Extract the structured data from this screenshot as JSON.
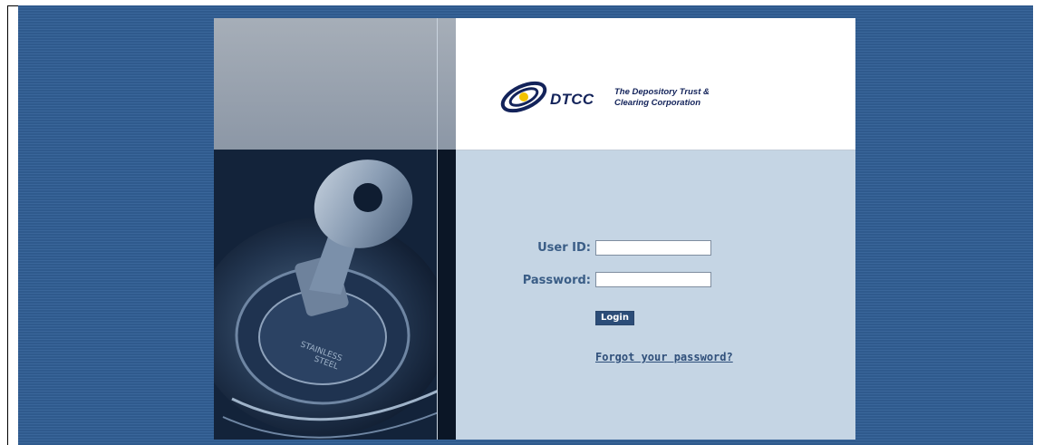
{
  "logo": {
    "brand": "DTCC",
    "tagline_line1": "The Depository Trust &",
    "tagline_line2": "Clearing Corporation"
  },
  "photo": {
    "key_text_1": "STAINLESS",
    "key_text_2": "STEEL"
  },
  "form": {
    "user_id_label": "User ID:",
    "user_id_value": "",
    "password_label": "Password:",
    "password_value": "",
    "login_button": "Login",
    "forgot_link": "Forgot your password?"
  },
  "colors": {
    "background": "#2f5a8d",
    "form_panel": "#c5d5e4",
    "label": "#3a5d86",
    "button": "#2c4d78",
    "brand": "#13235a"
  }
}
